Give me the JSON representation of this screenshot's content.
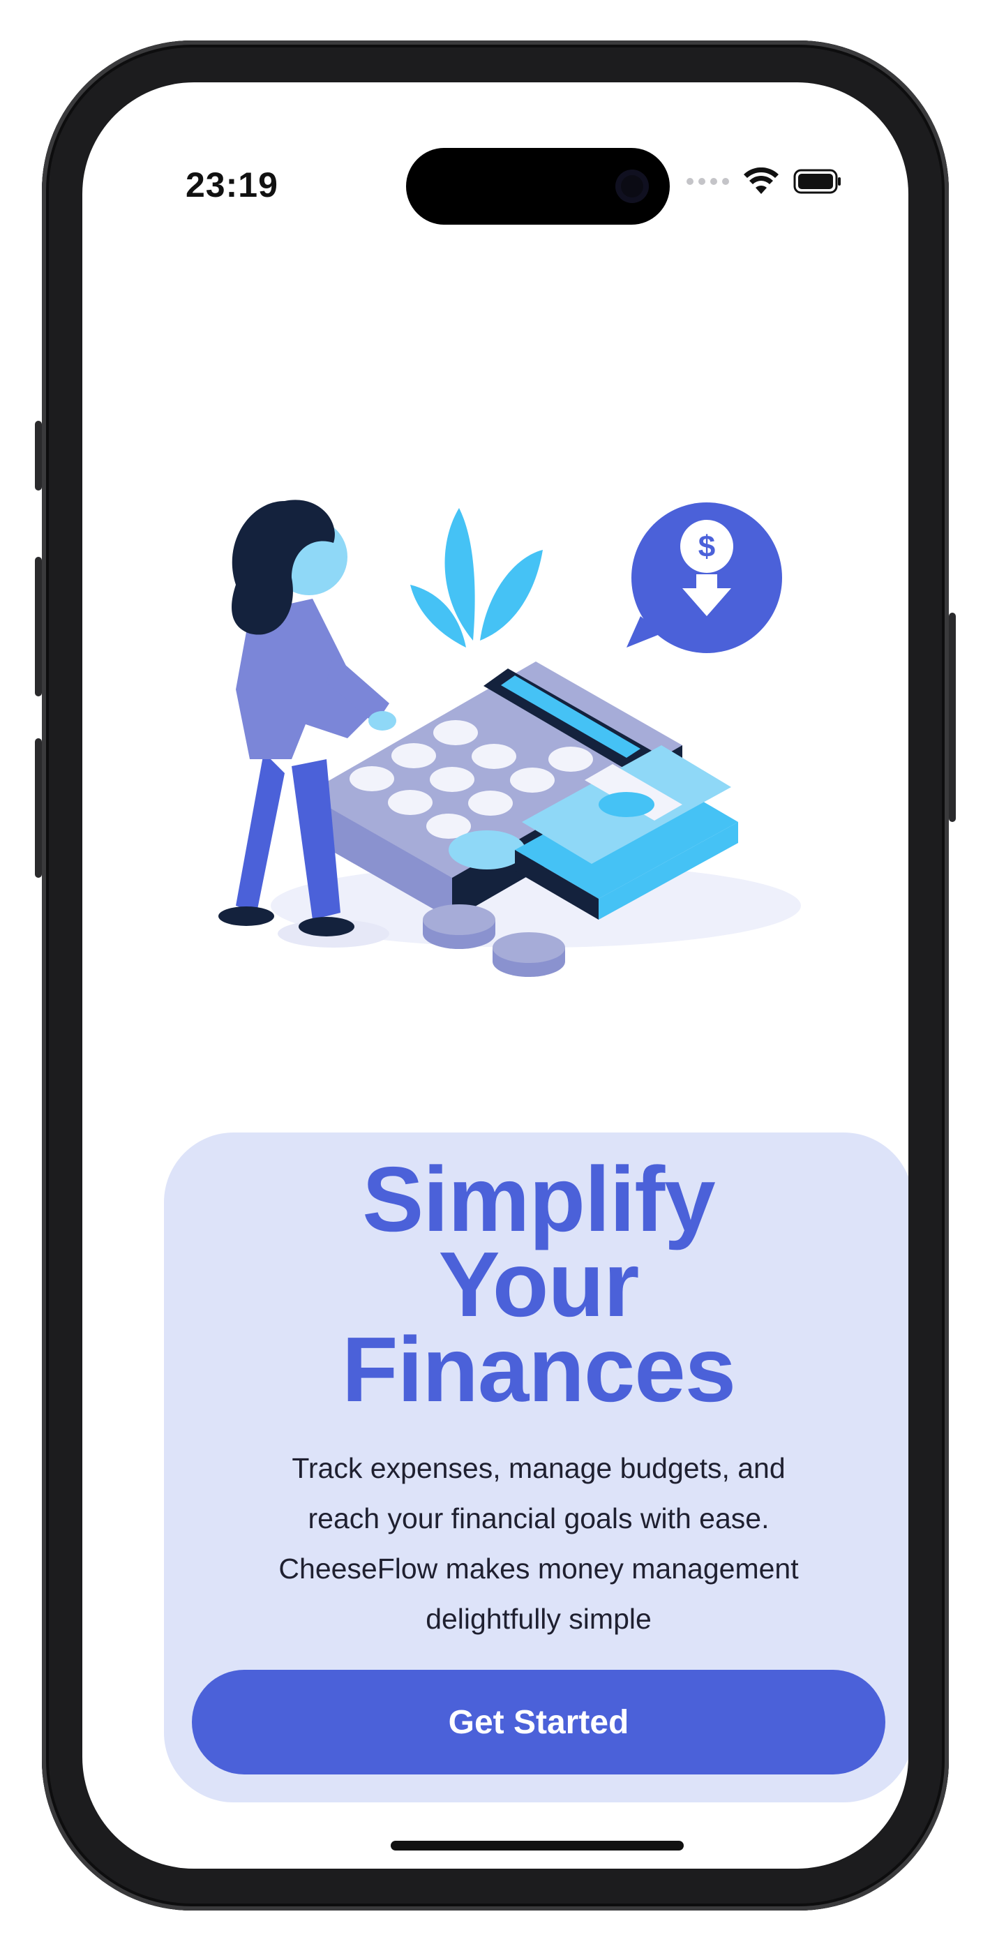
{
  "status_bar": {
    "time": "23:19",
    "icons": [
      "cellular-dots-icon",
      "wifi-icon",
      "battery-icon"
    ]
  },
  "illustration": {
    "icon": "finance-calculator-illustration",
    "badge_icon": "dollar-download-icon",
    "badge_text": "$"
  },
  "hero": {
    "title_lines": [
      "Simplify",
      "Your",
      "Finances"
    ],
    "description_lines": [
      "Track expenses, manage budgets, and",
      "reach your financial goals with ease.",
      "CheeseFlow makes money management",
      "delightfully simple"
    ],
    "cta_label": "Get Started"
  },
  "colors": {
    "accent": "#4b61d9",
    "card_bg": "#dde3f9",
    "light_blue": "#45c2f5",
    "navy": "#14223d"
  }
}
